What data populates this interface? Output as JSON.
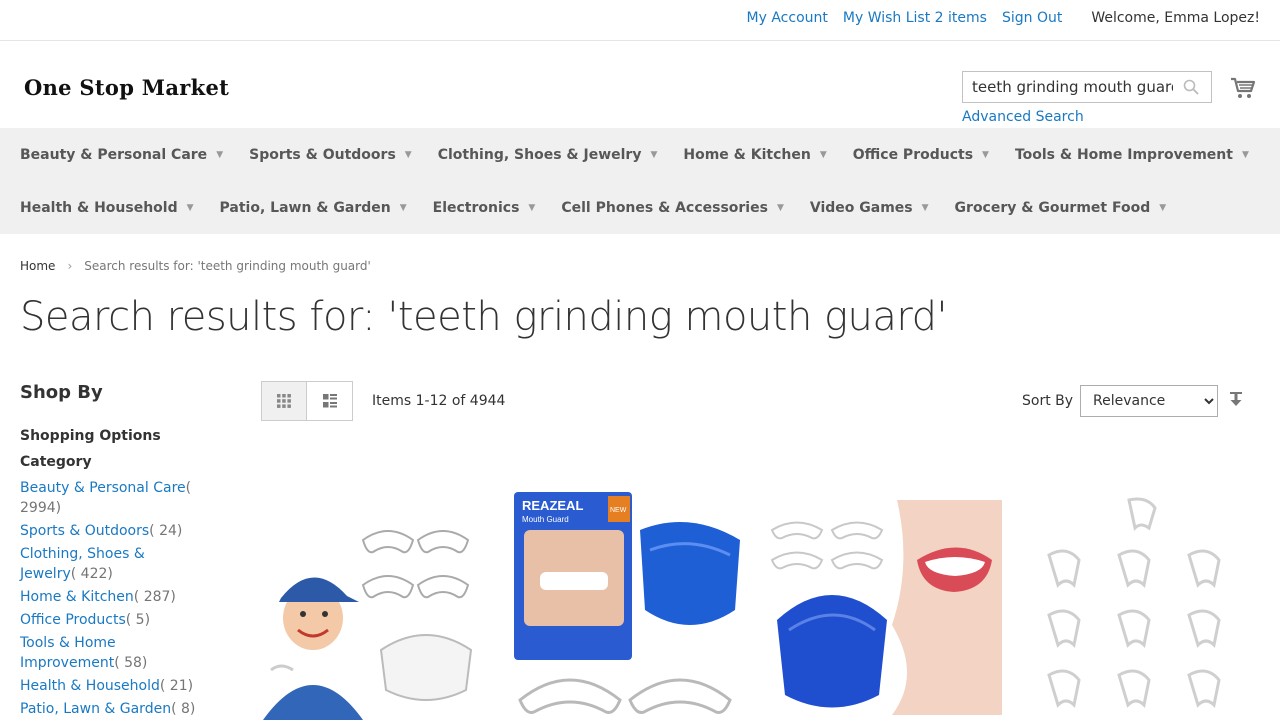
{
  "header_links": {
    "my_account": "My Account",
    "wish_list": "My Wish List",
    "wish_count": "2 items",
    "sign_out": "Sign Out",
    "welcome": "Welcome, Emma Lopez!"
  },
  "logo": "One Stop Market",
  "search": {
    "value": "teeth grinding mouth guard",
    "advanced": "Advanced Search"
  },
  "nav": {
    "row1": [
      "Beauty & Personal Care",
      "Sports & Outdoors",
      "Clothing, Shoes & Jewelry",
      "Home & Kitchen",
      "Office Products",
      "Tools & Home Improvement"
    ],
    "row2": [
      "Health & Household",
      "Patio, Lawn & Garden",
      "Electronics",
      "Cell Phones & Accessories",
      "Video Games",
      "Grocery & Gourmet Food"
    ]
  },
  "breadcrumb": {
    "home": "Home",
    "current": "Search results for: 'teeth grinding mouth guard'"
  },
  "page_title": "Search results for: 'teeth grinding mouth guard'",
  "sidebar": {
    "shop_by": "Shop By",
    "shopping_options": "Shopping Options",
    "category_title": "Category",
    "categories": [
      {
        "name": "Beauty & Personal Care",
        "count": "( 2994)"
      },
      {
        "name": "Sports & Outdoors",
        "count": "( 24)"
      },
      {
        "name": "Clothing, Shoes & Jewelry",
        "count": "( 422)"
      },
      {
        "name": "Home & Kitchen",
        "count": "( 287)"
      },
      {
        "name": "Office Products",
        "count": "( 5)"
      },
      {
        "name": "Tools & Home Improvement",
        "count": "( 58)"
      },
      {
        "name": "Health & Household",
        "count": "( 21)"
      },
      {
        "name": "Patio, Lawn & Garden",
        "count": "( 8)"
      }
    ]
  },
  "toolbar": {
    "amount": "Items 1-12 of 4944",
    "sort_label": "Sort By",
    "sort_options": [
      "Relevance"
    ],
    "sort_selected": "Relevance"
  },
  "products": [
    {
      "image": "kid-mouth-guard-image"
    },
    {
      "image": "reazeal-mouth-guard-image",
      "brand_text": "REAZEAL",
      "sub_text": "Mouth Guard",
      "badge": "NEW"
    },
    {
      "image": "smile-mouth-guard-image"
    },
    {
      "image": "clear-guards-set-image"
    }
  ],
  "colors": {
    "link": "#1979c3",
    "nav_bg": "#f0f0f0"
  }
}
